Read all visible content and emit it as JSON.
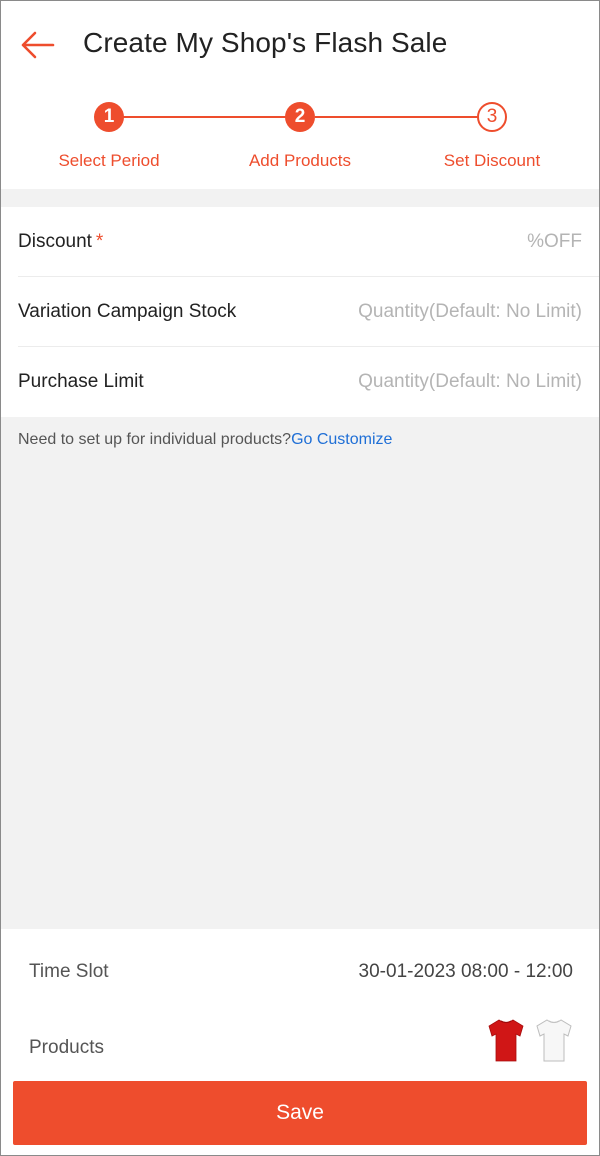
{
  "header": {
    "title": "Create My Shop's Flash Sale",
    "back_icon": "arrow-left-icon"
  },
  "stepper": {
    "steps": [
      {
        "number": "1",
        "label": "Select Period",
        "state": "done"
      },
      {
        "number": "2",
        "label": "Add Products",
        "state": "done"
      },
      {
        "number": "3",
        "label": "Set Discount",
        "state": "current"
      }
    ]
  },
  "form": {
    "discount": {
      "label": "Discount",
      "required_mark": "*",
      "placeholder": "%OFF"
    },
    "stock": {
      "label": "Variation Campaign Stock",
      "placeholder": "Quantity(Default: No Limit)"
    },
    "limit": {
      "label": "Purchase Limit",
      "placeholder": "Quantity(Default: No Limit)"
    }
  },
  "hint": {
    "text": "Need to set up for individual products?",
    "link": "Go Customize"
  },
  "summary": {
    "time_slot_label": "Time Slot",
    "time_slot_value": "30-01-2023 08:00 - 12:00",
    "products_label": "Products",
    "product_thumbs": [
      "red-tshirt-icon",
      "white-tshirt-icon"
    ]
  },
  "save_label": "Save",
  "colors": {
    "accent": "#ee4d2d",
    "link": "#1f6fd6",
    "background": "#f2f2f2"
  }
}
